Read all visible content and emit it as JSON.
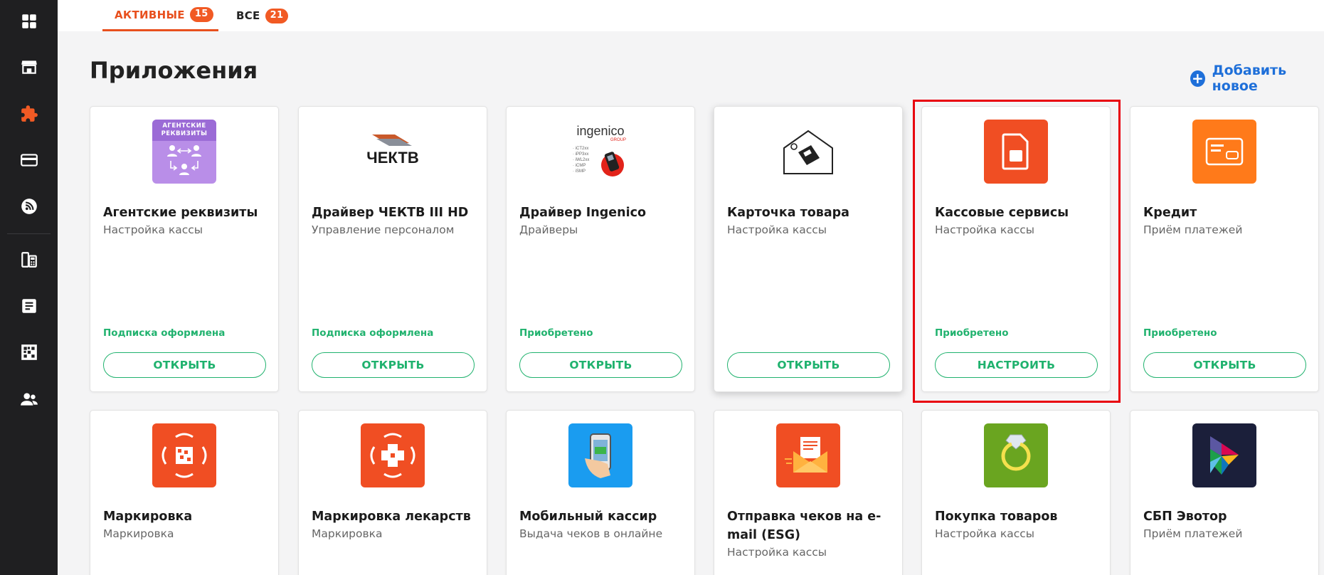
{
  "tabs": [
    {
      "label": "АКТИВНЫЕ",
      "count": "15"
    },
    {
      "label": "ВСЕ",
      "count": "21"
    }
  ],
  "header": {
    "title": "Приложения",
    "add_new": "Добавить новое"
  },
  "sidebar": {
    "items": [
      "dashboard-icon",
      "store-icon",
      "apps-puzzle-icon",
      "card-icon",
      "rss-icon",
      "pos-terminal-icon",
      "receipt-icon",
      "qr-code-icon",
      "users-icon"
    ]
  },
  "logos": {
    "agent": {
      "line1": "АГЕНТСКИЕ",
      "line2": "РЕКВИЗИТЫ"
    },
    "chektv": {
      "text": "ЧЕКТВ"
    },
    "ingenico": {
      "brand": "ingenico",
      "group": "GROUP",
      "models": [
        "· iCT2xx",
        "· iPP3xx",
        "· iWL2xx",
        "· iCMP",
        "· iSMP"
      ]
    }
  },
  "cards": [
    {
      "name": "Агентские реквизиты",
      "category": "Настройка кассы",
      "status": "Подписка оформлена",
      "action": "ОТКРЫТЬ"
    },
    {
      "name": "Драйвер ЧЕКТВ III HD",
      "category": "Управление персоналом",
      "status": "Подписка оформлена",
      "action": "ОТКРЫТЬ"
    },
    {
      "name": "Драйвер Ingenico",
      "category": "Драйверы",
      "status": "Приобретено",
      "action": "ОТКРЫТЬ"
    },
    {
      "name": "Карточка товара",
      "category": "Настройка кассы",
      "status": "",
      "action": "ОТКРЫТЬ"
    },
    {
      "name": "Кассовые сервисы",
      "category": "Настройка кассы",
      "status": "Приобретено",
      "action": "НАСТРОИТЬ"
    },
    {
      "name": "Кредит",
      "category": "Приём платежей",
      "status": "Приобретено",
      "action": "ОТКРЫТЬ"
    },
    {
      "name": "Маркировка",
      "category": "Маркировка"
    },
    {
      "name": "Маркировка лекарств",
      "category": "Маркировка"
    },
    {
      "name": "Мобильный кассир",
      "category": "Выдача чеков в онлайне"
    },
    {
      "name": "Отправка чеков на e-mail (ESG)",
      "category": "Настройка кассы"
    },
    {
      "name": "Покупка товаров",
      "category": "Настройка кассы"
    },
    {
      "name": "СБП Эвотор",
      "category": "Приём платежей"
    }
  ],
  "colors": {
    "accent": "#e8501e",
    "success": "#20b26e",
    "link": "#1e6fd9",
    "highlight": "#e8000d"
  }
}
